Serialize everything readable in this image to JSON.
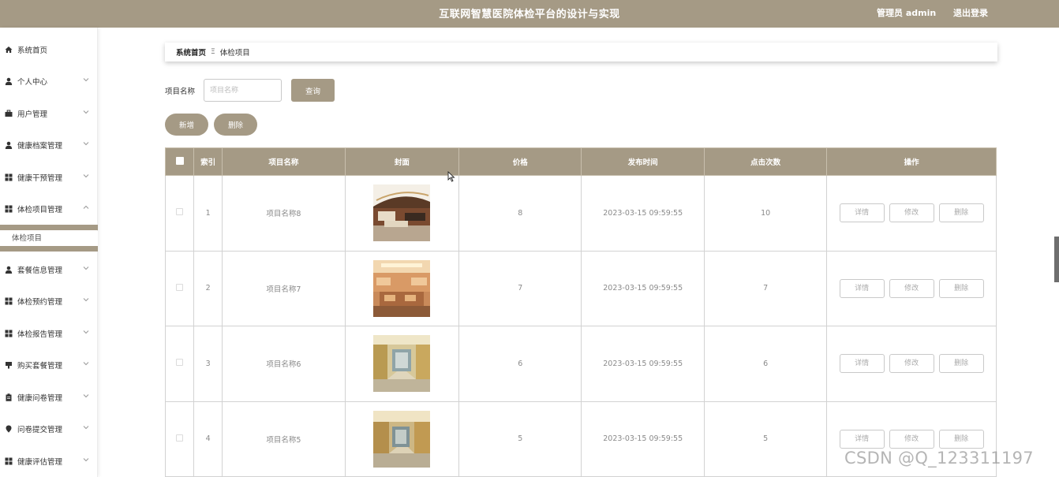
{
  "header": {
    "title": "互联网智慧医院体检平台的设计与实现",
    "admin_label": "管理员 admin",
    "logout_label": "退出登录"
  },
  "sidebar": {
    "items": [
      {
        "label": "系统首页",
        "icon": "home-icon"
      },
      {
        "label": "个人中心",
        "icon": "user-icon"
      },
      {
        "label": "用户管理",
        "icon": "briefcase-icon"
      },
      {
        "label": "健康档案管理",
        "icon": "user-icon"
      },
      {
        "label": "健康干预管理",
        "icon": "grid-icon"
      },
      {
        "label": "体检项目管理",
        "icon": "grid-icon"
      },
      {
        "label": "套餐信息管理",
        "icon": "user-icon"
      },
      {
        "label": "体检预约管理",
        "icon": "grid-icon"
      },
      {
        "label": "体检报告管理",
        "icon": "grid-icon"
      },
      {
        "label": "购买套餐管理",
        "icon": "gavel-icon"
      },
      {
        "label": "健康问卷管理",
        "icon": "clipboard-icon"
      },
      {
        "label": "问卷提交管理",
        "icon": "pin-icon"
      },
      {
        "label": "健康评估管理",
        "icon": "grid-icon"
      }
    ],
    "submenu_label": "体检项目"
  },
  "breadcrumb": {
    "home": "系统首页",
    "separator": "Ξ",
    "current": "体检项目"
  },
  "search": {
    "label": "项目名称",
    "placeholder": "项目名称",
    "value": "",
    "query_label": "查询"
  },
  "toolbar": {
    "add_label": "新增",
    "delete_label": "删除"
  },
  "table": {
    "headers": [
      "",
      "索引",
      "项目名称",
      "封面",
      "价格",
      "发布时间",
      "点击次数",
      "操作"
    ],
    "rows": [
      {
        "index": "1",
        "name": "项目名称8",
        "price": "8",
        "time": "2023-03-15 09:59:55",
        "clicks": "10"
      },
      {
        "index": "2",
        "name": "项目名称7",
        "price": "7",
        "time": "2023-03-15 09:59:55",
        "clicks": "7"
      },
      {
        "index": "3",
        "name": "项目名称6",
        "price": "6",
        "time": "2023-03-15 09:59:55",
        "clicks": "6"
      },
      {
        "index": "4",
        "name": "项目名称5",
        "price": "5",
        "time": "2023-03-15 09:59:55",
        "clicks": "5"
      }
    ],
    "actions": {
      "detail": "详情",
      "edit": "修改",
      "delete": "删除"
    }
  },
  "watermark": "CSDN @Q_123311197",
  "colors": {
    "accent": "#a59a85",
    "border": "#d2d2d2"
  }
}
